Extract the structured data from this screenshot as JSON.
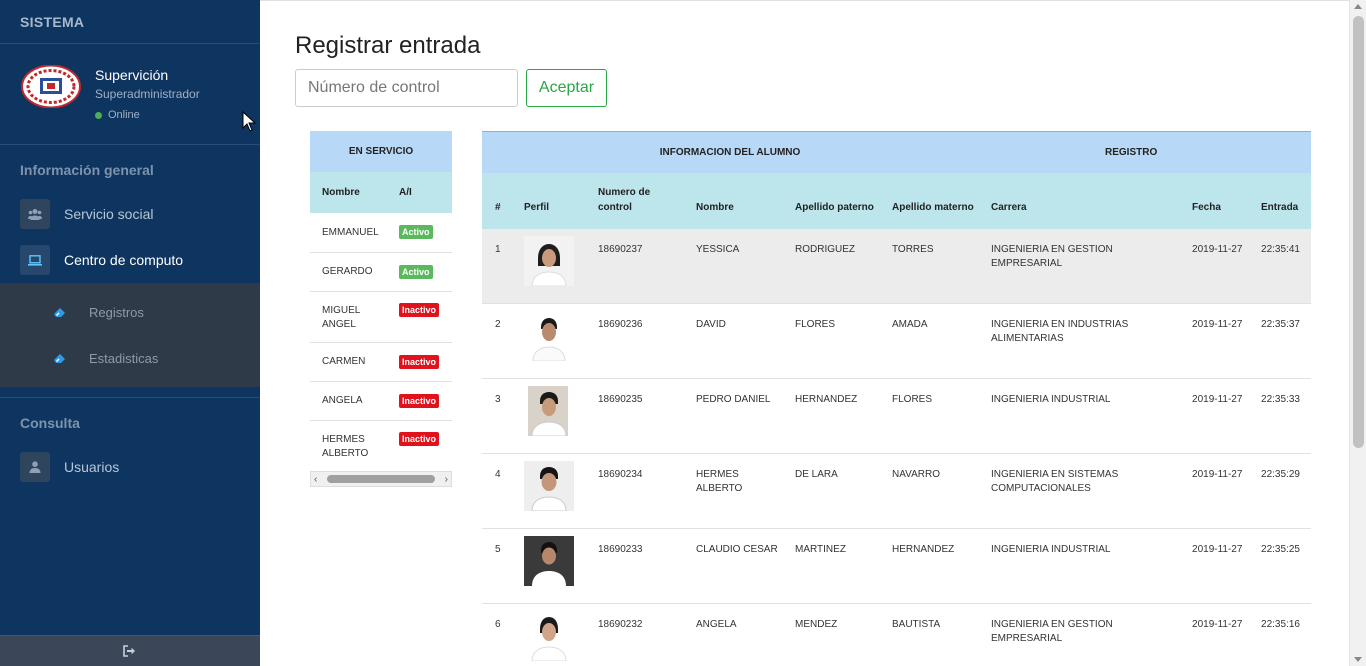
{
  "sidebar": {
    "brand": "SISTEMA",
    "user": {
      "name": "Supervición",
      "role": "Superadministrador",
      "status": "Online"
    },
    "sections": [
      {
        "title": "Información general"
      },
      {
        "title": "Consulta"
      }
    ],
    "items": [
      {
        "label": "Servicio social",
        "icon": "users-icon"
      },
      {
        "label": "Centro de computo",
        "icon": "laptop-icon"
      },
      {
        "label": "Usuarios",
        "icon": "user-icon"
      }
    ],
    "submenu": [
      {
        "label": "Registros",
        "icon": "eraser-icon"
      },
      {
        "label": "Estadisticas",
        "icon": "eraser-icon"
      }
    ],
    "footer_icon": "sign-out-icon"
  },
  "main": {
    "title": "Registrar entrada",
    "control_placeholder": "Número de control",
    "accept_label": "Aceptar"
  },
  "service": {
    "header": "EN SERVICIO",
    "columns": [
      "Nombre",
      "A/I"
    ],
    "rows": [
      {
        "name": "EMMANUEL",
        "status": "Activo"
      },
      {
        "name": "GERARDO",
        "status": "Activo"
      },
      {
        "name": "MIGUEL ANGEL",
        "status": "Inactivo"
      },
      {
        "name": "CARMEN",
        "status": "Inactivo"
      },
      {
        "name": "ANGELA",
        "status": "Inactivo"
      },
      {
        "name": "HERMES ALBERTO",
        "status": "Inactivo"
      }
    ]
  },
  "students": {
    "group_headers": [
      "INFORMACION DEL ALUMNO",
      "REGISTRO"
    ],
    "columns": [
      "#",
      "Perfil",
      "Numero de control",
      "Nombre",
      "Apellido paterno",
      "Apellido materno",
      "Carrera",
      "Fecha",
      "Entrada"
    ],
    "rows": [
      {
        "n": "1",
        "control": "18690237",
        "nombre": "YESSICA",
        "paterno": "RODRIGUEZ",
        "materno": "TORRES",
        "carrera": "INGENIERIA EN GESTION EMPRESARIAL",
        "fecha": "2019-11-27",
        "entrada": "22:35:41"
      },
      {
        "n": "2",
        "control": "18690236",
        "nombre": "DAVID",
        "paterno": "FLORES",
        "materno": "AMADA",
        "carrera": "INGENIERIA EN INDUSTRIAS ALIMENTARIAS",
        "fecha": "2019-11-27",
        "entrada": "22:35:37"
      },
      {
        "n": "3",
        "control": "18690235",
        "nombre": "PEDRO DANIEL",
        "paterno": "HERNANDEZ",
        "materno": "FLORES",
        "carrera": "INGENIERIA INDUSTRIAL",
        "fecha": "2019-11-27",
        "entrada": "22:35:33"
      },
      {
        "n": "4",
        "control": "18690234",
        "nombre": "HERMES ALBERTO",
        "paterno": "DE LARA",
        "materno": "NAVARRO",
        "carrera": "INGENIERIA EN SISTEMAS COMPUTACIONALES",
        "fecha": "2019-11-27",
        "entrada": "22:35:29"
      },
      {
        "n": "5",
        "control": "18690233",
        "nombre": "CLAUDIO CESAR",
        "paterno": "MARTINEZ",
        "materno": "HERNANDEZ",
        "carrera": "INGENIERIA INDUSTRIAL",
        "fecha": "2019-11-27",
        "entrada": "22:35:25"
      },
      {
        "n": "6",
        "control": "18690232",
        "nombre": "ANGELA",
        "paterno": "MENDEZ",
        "materno": "BAUTISTA",
        "carrera": "INGENIERIA EN GESTION EMPRESARIAL",
        "fecha": "2019-11-27",
        "entrada": "22:35:16"
      }
    ]
  }
}
